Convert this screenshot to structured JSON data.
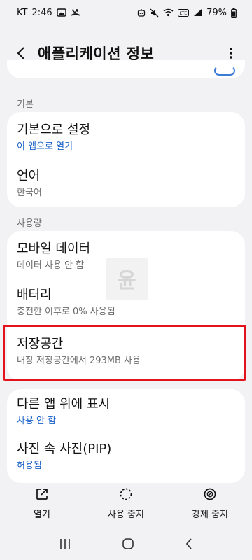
{
  "status_bar": {
    "carrier": "KT",
    "time": "2:46",
    "battery": "79%"
  },
  "header": {
    "title": "애플리케이션 정보"
  },
  "sections": {
    "default": {
      "label": "기본",
      "items": [
        {
          "title": "기본으로 설정",
          "subtitle": "이 앱으로 열기"
        },
        {
          "title": "언어",
          "subtitle": "한국어"
        }
      ]
    },
    "usage": {
      "label": "사용량",
      "items": [
        {
          "title": "모바일 데이터",
          "subtitle": "데이터 사용 안 함"
        },
        {
          "title": "배터리",
          "subtitle": "충전한 이후로 0% 사용됨"
        },
        {
          "title": "저장공간",
          "subtitle": "내장 저장공간에서 293MB 사용"
        }
      ]
    },
    "extra": {
      "items": [
        {
          "title": "다른 앱 위에 표시",
          "subtitle": "사용 안 함"
        },
        {
          "title": "사진 속 사진(PIP)",
          "subtitle": "허용됨"
        }
      ]
    }
  },
  "watermark": {
    "text": "윤"
  },
  "bottom_actions": {
    "open": "열기",
    "stop_usage": "사용 중지",
    "force_stop": "강제 중지"
  },
  "icons": {
    "back": "chevron-left-icon",
    "more": "more-vertical-icon",
    "open": "open-external-icon",
    "stop_usage": "dashed-circle-icon",
    "force_stop": "block-icon",
    "nav_recent": "recent-apps-icon",
    "nav_home": "home-icon",
    "nav_back": "back-icon"
  },
  "colors": {
    "accent_blue": "#1a62c8",
    "highlight_red": "#e3131e",
    "background": "#f2f2f4"
  }
}
